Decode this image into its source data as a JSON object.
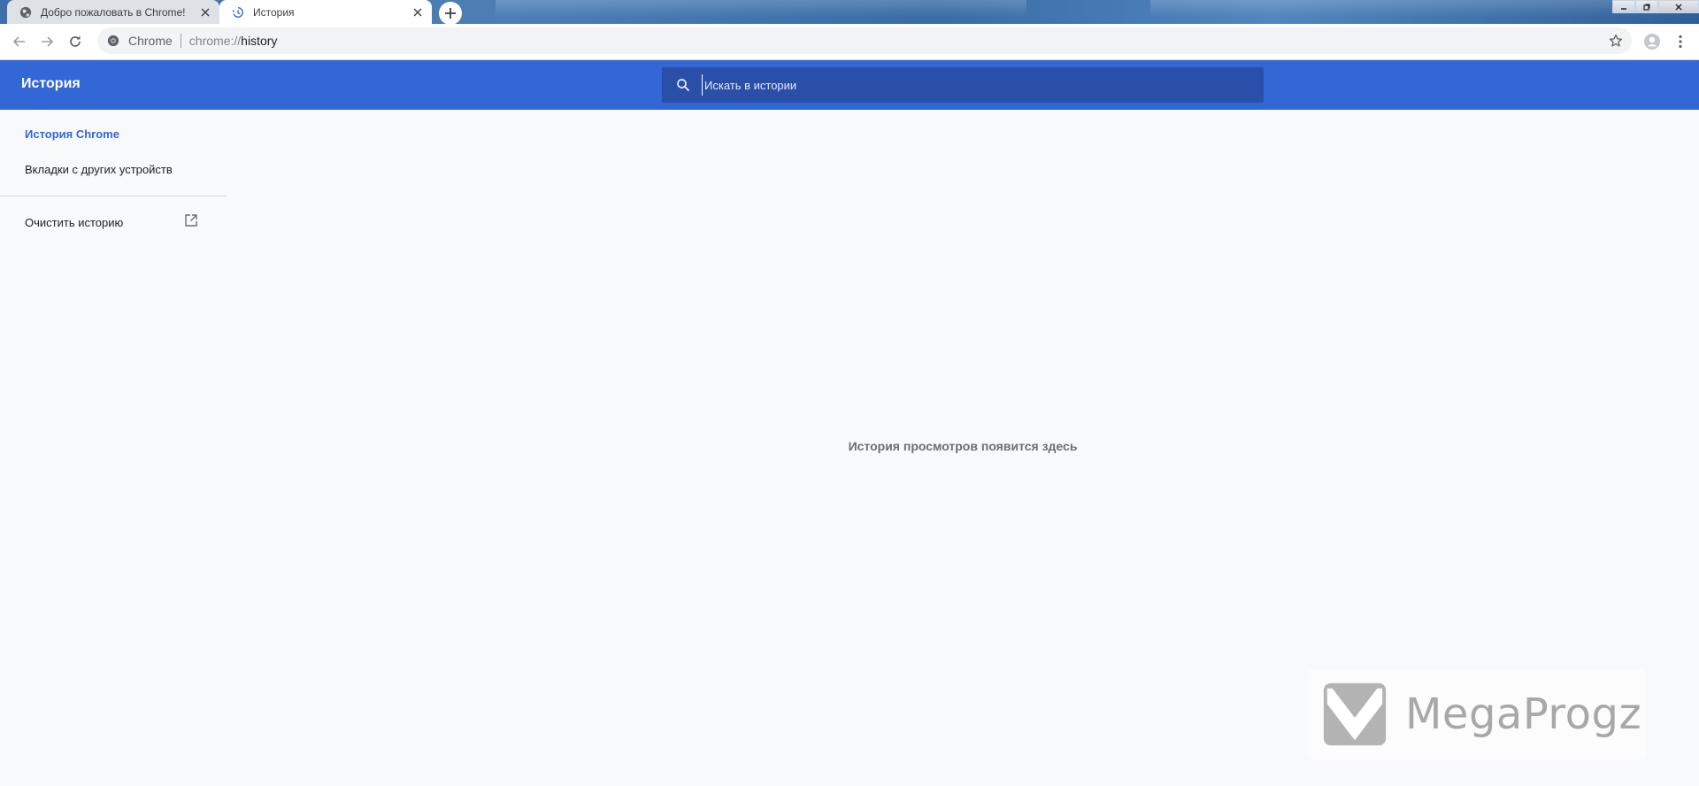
{
  "browser": {
    "tabs": [
      {
        "title": "Добро пожаловать в Chrome!",
        "icon": "globe-icon",
        "active": false
      },
      {
        "title": "История",
        "icon": "history-icon",
        "active": true
      }
    ],
    "omnibox": {
      "chip": "Chrome",
      "url_scheme": "chrome://",
      "url_path": "history"
    }
  },
  "app": {
    "title": "История",
    "search_placeholder": "Искать в истории"
  },
  "sidenav": {
    "items": [
      {
        "label": "История Chrome",
        "selected": true
      },
      {
        "label": "Вкладки с других устройств",
        "selected": false
      }
    ],
    "clear_label": "Очистить историю"
  },
  "main": {
    "empty_message": "История просмотров появится здесь"
  },
  "watermark": {
    "text": "MegaProgz"
  },
  "colors": {
    "header": "#3367d6",
    "search_bg": "#2a4fa8",
    "accent": "#3367d6",
    "page_bg": "#f8f9fb"
  }
}
